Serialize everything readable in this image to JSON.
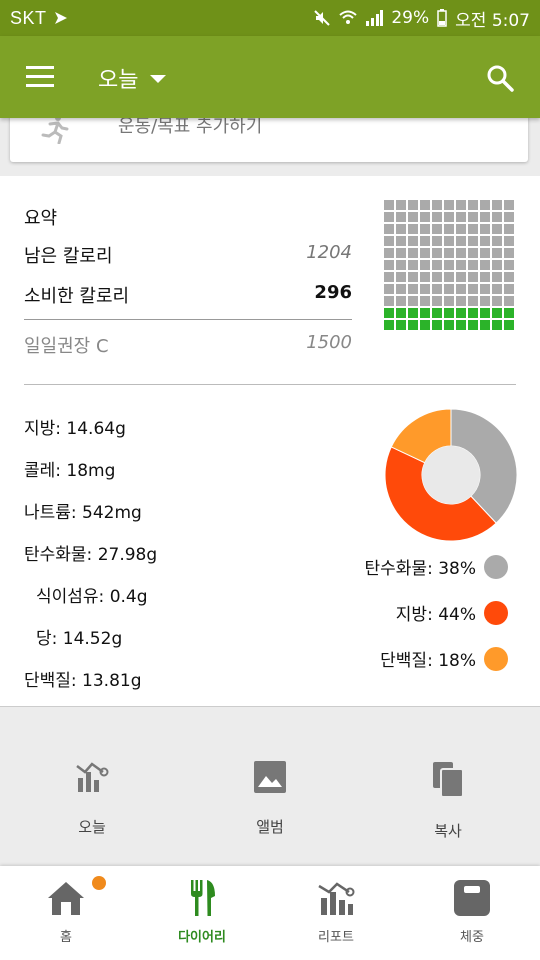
{
  "status_bar": {
    "carrier": "SKT",
    "battery": "29%",
    "time": "오전 5:07"
  },
  "app_bar": {
    "title": "오늘"
  },
  "exercise_card": {
    "label": "운동/목표 추가하기"
  },
  "summary": {
    "title": "요약",
    "remaining_label": "남은 칼로리",
    "remaining_value": "1204",
    "consumed_label": "소비한 칼로리",
    "consumed_value": "296",
    "daily_label": "일일권장 C",
    "daily_value": "1500"
  },
  "waffle": {
    "total_cells": 121,
    "filled_cells": 22,
    "colors": {
      "empty": "#aaaaaa",
      "filled": "#2bb329"
    }
  },
  "nutrients": {
    "fat": "지방: 14.64g",
    "cholesterol": "콜레: 18mg",
    "sodium": "나트륨: 542mg",
    "carbs": "탄수화물: 27.98g",
    "fiber": "식이섬유: 0.4g",
    "sugar": "당: 14.52g",
    "protein": "단백질: 13.81g"
  },
  "chart_data": {
    "type": "pie",
    "categories": [
      "탄수화물",
      "지방",
      "단백질"
    ],
    "values": [
      38,
      44,
      18
    ],
    "colors": [
      "#aaaaaa",
      "#ff4a0a",
      "#ff9a2a"
    ],
    "legend": [
      "탄수화물: 38%",
      "지방: 44%",
      "단백질: 18%"
    ]
  },
  "actions": {
    "today": "오늘",
    "album": "앨범",
    "copy": "복사"
  },
  "bottom_nav": {
    "home": "홈",
    "diary": "다이어리",
    "report": "리포트",
    "weight": "체중",
    "accent": "#2e8b1f",
    "badge_color": "#f08a1c"
  }
}
